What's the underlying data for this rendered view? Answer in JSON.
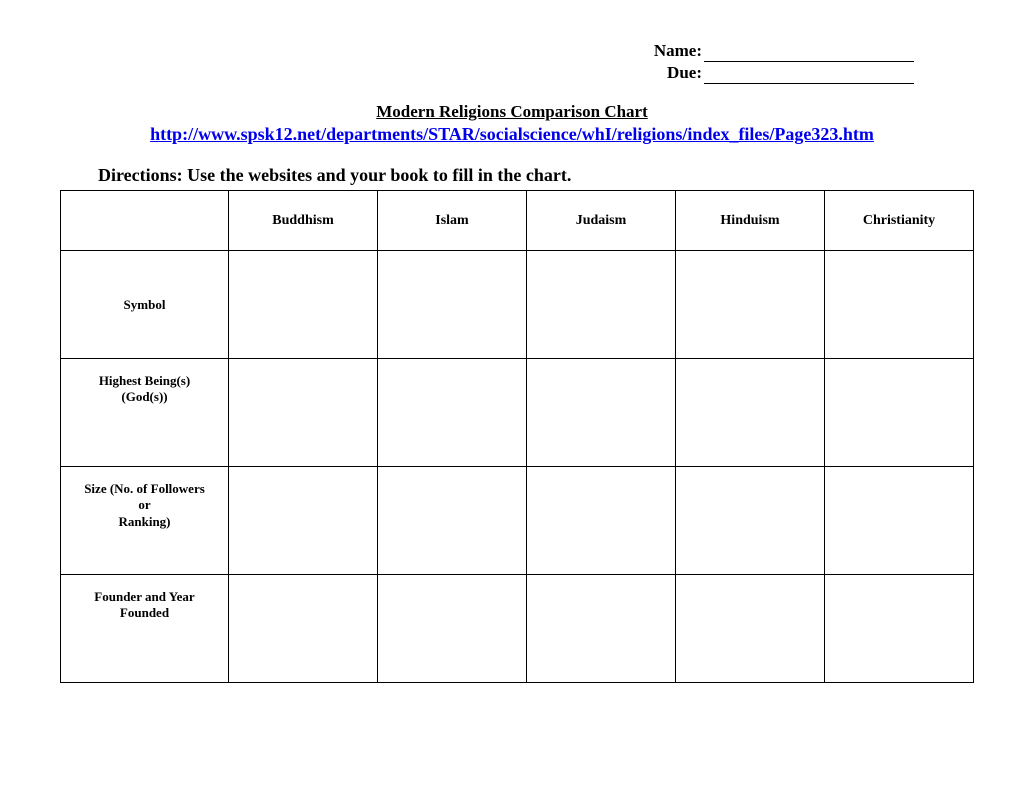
{
  "header": {
    "name_label": "Name:",
    "due_label": "Due:"
  },
  "title": "Modern Religions Comparison Chart",
  "link_text": "http://www.spsk12.net/departments/STAR/socialscience/whI/religions/index_files/Page323.htm",
  "directions": "Directions:  Use the websites and your book to fill in the chart.",
  "chart_data": {
    "type": "table",
    "columns": [
      "Buddhism",
      "Islam",
      "Judaism",
      "Hinduism",
      "Christianity"
    ],
    "rows": [
      {
        "label": "Symbol",
        "values": [
          "",
          "",
          "",
          "",
          ""
        ]
      },
      {
        "label": "Highest Being(s)\n(God(s))",
        "values": [
          "",
          "",
          "",
          "",
          ""
        ]
      },
      {
        "label": "Size (No. of Followers\nor\nRanking)",
        "values": [
          "",
          "",
          "",
          "",
          ""
        ]
      },
      {
        "label": "Founder and Year\nFounded",
        "values": [
          "",
          "",
          "",
          "",
          ""
        ]
      }
    ]
  }
}
